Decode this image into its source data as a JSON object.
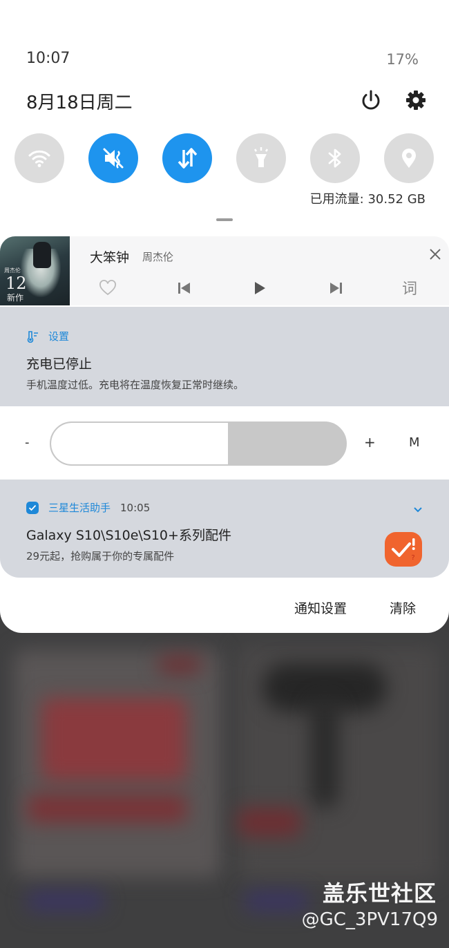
{
  "status_bar": {
    "time": "10:07",
    "battery": "17%"
  },
  "header": {
    "date": "8月18日周二"
  },
  "quick_settings": [
    {
      "name": "wifi",
      "state": "off"
    },
    {
      "name": "mute",
      "state": "on"
    },
    {
      "name": "mobile-data",
      "state": "on"
    },
    {
      "name": "flashlight",
      "state": "off"
    },
    {
      "name": "bluetooth",
      "state": "off"
    },
    {
      "name": "location",
      "state": "off"
    }
  ],
  "data_usage": "已用流量: 30.52 GB",
  "music": {
    "song": "大笨钟",
    "artist": "周杰伦",
    "lyrics_label": "词",
    "album_number": "12",
    "album_text": "新作"
  },
  "notification_charging": {
    "app": "设置",
    "title": "充电已停止",
    "text": "手机温度过低。充电将在温度恢复正常时继续。"
  },
  "brightness": {
    "minus": "-",
    "plus": "+",
    "mode": "M",
    "level": 0.6
  },
  "notification_promo": {
    "app": "三星生活助手",
    "time": "10:05",
    "title": "Galaxy S10\\S10e\\S10+系列配件",
    "text": "29元起，抢购属于你的专属配件"
  },
  "actions": {
    "settings": "通知设置",
    "clear": "清除"
  },
  "watermark": {
    "line1": "盖乐世社区",
    "line2": "@GC_3PV17Q9"
  },
  "colors": {
    "accent": "#1e94ee",
    "tile_off": "#dcdcdc",
    "card": "#d5d8de",
    "promo_icon": "#f0642e"
  }
}
